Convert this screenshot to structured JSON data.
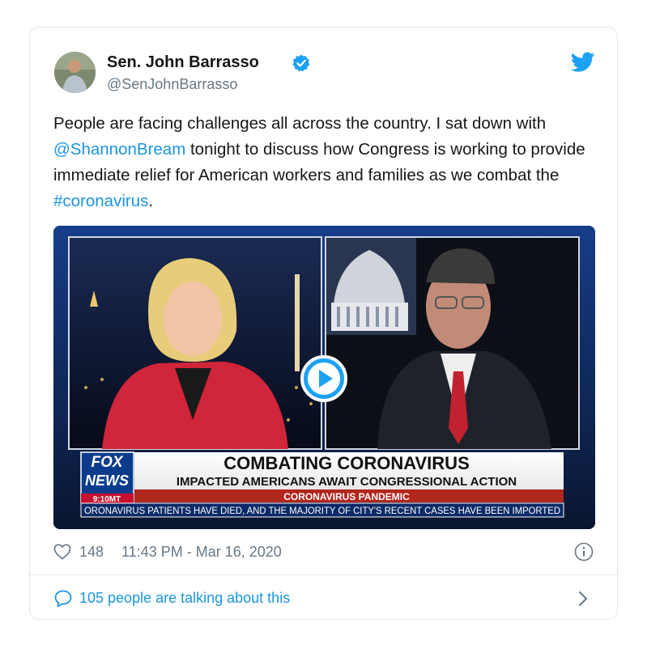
{
  "tweet": {
    "author_name": "Sen. John Barrasso",
    "handle": "@SenJohnBarrasso",
    "text_part1": "People are facing challenges all across the country. I sat down with ",
    "mention": "@ShannonBream",
    "text_part2": " tonight to discuss how Congress is working to provide immediate relief for American workers and families as we combat the ",
    "hashtag": "#coronavirus",
    "text_part3": "."
  },
  "video": {
    "banner_headline": "COMBATING CORONAVIRUS",
    "banner_subhead": "IMPACTED AMERICANS AWAIT CONGRESSIONAL ACTION",
    "banner_tag": "CORONAVIRUS PANDEMIC",
    "ticker": "ORONAVIRUS PATIENTS HAVE DIED, AND THE MAJORITY OF CITY'S RECENT CASES HAVE BEEN IMPORTED",
    "logo_line1": "FOX",
    "logo_line2": "NEWS",
    "clock": "9:10MT"
  },
  "footer": {
    "likes": "148",
    "timestamp": "11:43 PM - Mar 16, 2020",
    "talking": "105 people are talking about this"
  },
  "colors": {
    "link": "#1b95e0",
    "secondary": "#657786",
    "border": "#e1e8ed"
  },
  "icons": [
    "verified-icon",
    "twitter-bird-icon",
    "play-icon",
    "heart-icon",
    "info-icon",
    "speech-bubble-icon",
    "chevron-right-icon"
  ]
}
